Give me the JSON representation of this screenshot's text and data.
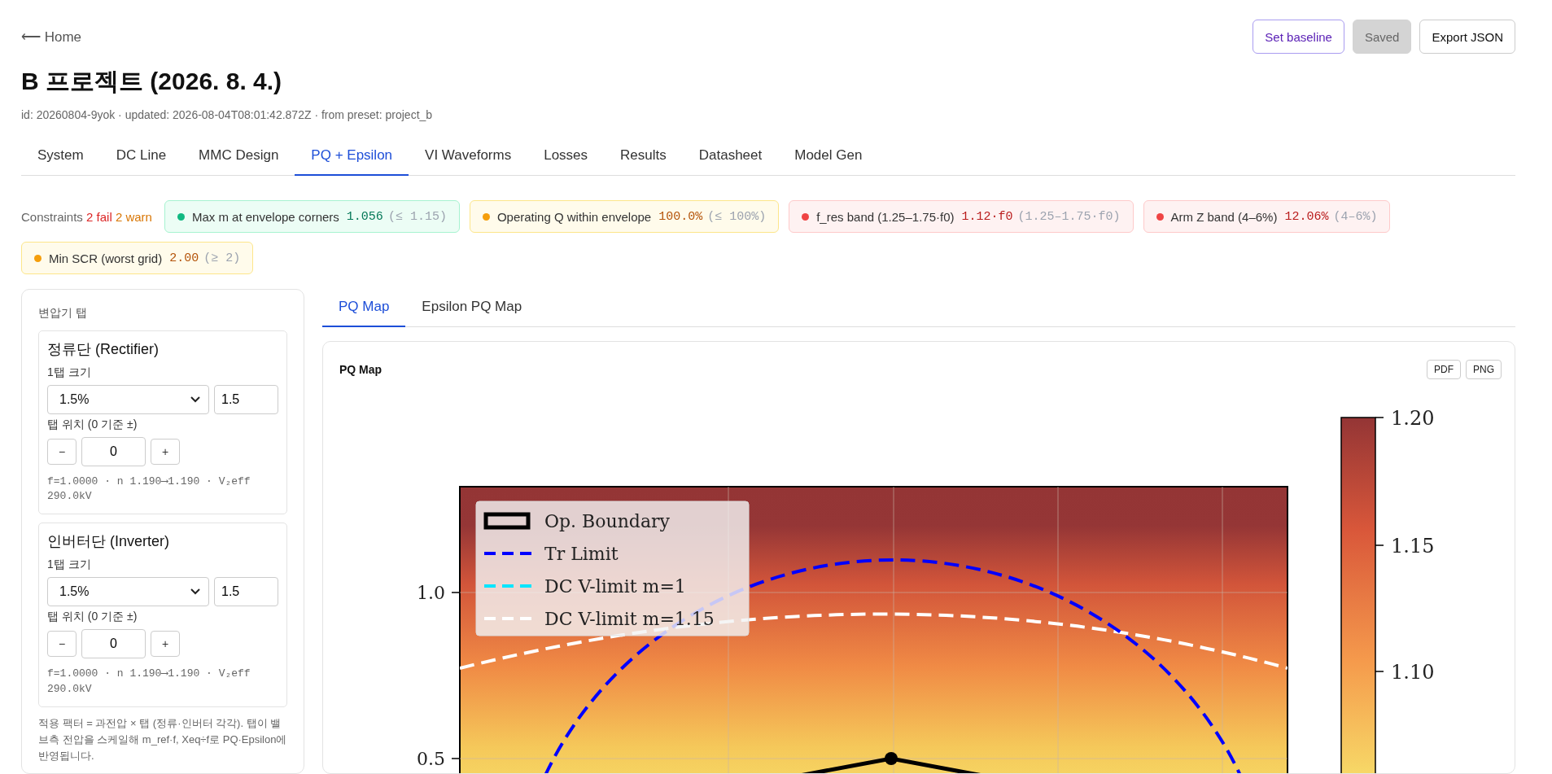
{
  "back_link": "⟵ Home",
  "actions": [
    {
      "label": "Set baseline",
      "kind": "accent",
      "disabled": false
    },
    {
      "label": "Saved",
      "kind": "plain",
      "disabled": true
    },
    {
      "label": "Export JSON",
      "kind": "plain",
      "disabled": false
    }
  ],
  "title": "B 프로젝트 (2026. 8. 4.)",
  "meta": "id: 20260804-9yok · updated: 2026-08-04T08:01:42.872Z · from preset: project_b",
  "tabs": [
    {
      "label": "System",
      "selected": false
    },
    {
      "label": "DC Line",
      "selected": false
    },
    {
      "label": "MMC Design",
      "selected": false
    },
    {
      "label": "PQ + Epsilon",
      "selected": true
    },
    {
      "label": "VI Waveforms",
      "selected": false
    },
    {
      "label": "Losses",
      "selected": false
    },
    {
      "label": "Results",
      "selected": false
    },
    {
      "label": "Datasheet",
      "selected": false
    },
    {
      "label": "Model Gen",
      "selected": false
    }
  ],
  "constraints": {
    "label": "Constraints",
    "fail": "2 fail",
    "warn": "2 warn",
    "items": [
      {
        "color": "#10b981",
        "name": "Max m at envelope corners",
        "value": "1.056",
        "limit": "(≤ 1.15)"
      },
      {
        "color": "#f59e0b",
        "name": "Operating Q within envelope",
        "value": "100.0%",
        "limit": "(≤ 100%)"
      },
      {
        "color": "#ef4444",
        "name": "f_res band (1.25–1.75·f0)",
        "value": "1.12·f0",
        "limit": "(1.25–1.75·f0)"
      },
      {
        "color": "#ef4444",
        "name": "Arm Z band (4–6%)",
        "value": "12.06%",
        "limit": "(4–6%)"
      },
      {
        "color": "#f59e0b",
        "name": "Min SCR (worst grid)",
        "value": "2.00",
        "limit": "(≥ 2)"
      }
    ]
  },
  "tap_panel": {
    "title": "변압기 탭",
    "sections": [
      {
        "heading": "정류단 (Rectifier)",
        "step_label": "1탭 크기",
        "step_select": "1.5%",
        "step_value": "1.5",
        "pos_label": "탭 위치 (0 기준 ±)",
        "minus": "−",
        "pos_value": "0",
        "plus": "+",
        "readout": "f=1.0000 · n 1.190⟶1.190 · V₂eff 290.0kV"
      },
      {
        "heading": "인버터단 (Inverter)",
        "step_label": "1탭 크기",
        "step_select": "1.5%",
        "step_value": "1.5",
        "pos_label": "탭 위치 (0 기준 ±)",
        "minus": "−",
        "pos_value": "0",
        "plus": "+",
        "readout": "f=1.0000 · n 1.190⟶1.190 · V₂eff 290.0kV"
      }
    ],
    "note": "적용 팩터 = 과전압 × 탭 (정류·인버터 각각). 탭이 밸브측 전압을 스케일해 m_ref·f, Xeq÷f로 PQ·Epsilon에 반영됩니다."
  },
  "subtabs": [
    {
      "label": "PQ Map",
      "selected": true
    },
    {
      "label": "Epsilon PQ Map",
      "selected": false
    }
  ],
  "chart_card": {
    "title": "PQ Map",
    "buttons": [
      "PDF",
      "PNG"
    ],
    "legend": [
      {
        "kind": "box",
        "label": "Op. Boundary",
        "color": "#000000"
      },
      {
        "kind": "dashed",
        "label": "Tr Limit",
        "color": "#0000ff"
      },
      {
        "kind": "dashed",
        "label": "DC V-limit m=1",
        "color": "#00e5ff"
      },
      {
        "kind": "dashed",
        "label": "DC V-limit m=1.15",
        "color": "#ffffff"
      }
    ],
    "y_ticks": [
      "1.0",
      "0.5"
    ],
    "colorbar_ticks": [
      "1.20",
      "1.15",
      "1.10"
    ]
  }
}
